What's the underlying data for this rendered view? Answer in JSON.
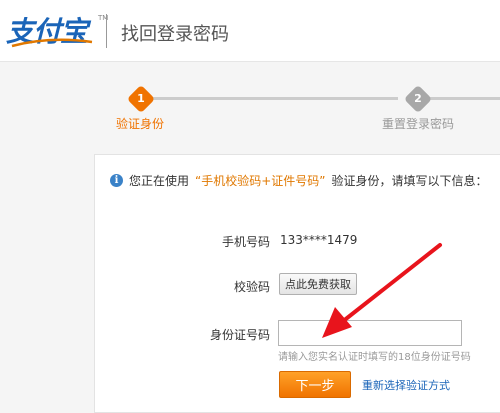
{
  "header": {
    "logo_text": "支付宝",
    "logo_tm": "TM",
    "title": "找回登录密码"
  },
  "steps": [
    {
      "number": "1",
      "label": "验证身份",
      "state": "active"
    },
    {
      "number": "2",
      "label": "重置登录密码",
      "state": "inactive"
    }
  ],
  "notice": {
    "prefix": "您正在使用",
    "method": "“手机校验码+证件号码”",
    "suffix": "验证身份，请填写以下信息："
  },
  "form": {
    "phone_label": "手机号码",
    "phone_value": "133****1479",
    "code_label": "校验码",
    "sms_button": "点此免费获取",
    "id_label": "身份证号码",
    "id_value": "",
    "id_hint": "请输入您实名认证时填写的18位身份证号码",
    "next_button": "下一步",
    "alt_link": "重新选择验证方式"
  },
  "colors": {
    "accent": "#f07300",
    "brand": "#1a64b8",
    "inactive_step": "#999999",
    "arrow": "#e8141c"
  }
}
